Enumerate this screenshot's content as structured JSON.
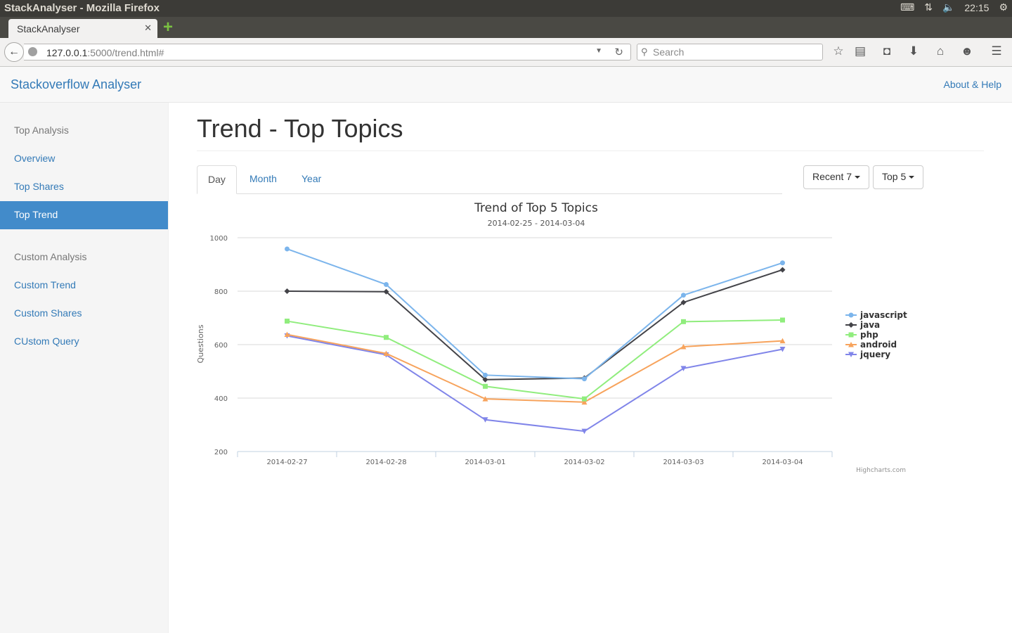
{
  "os": {
    "window_title": "StackAnalyser - Mozilla Firefox",
    "clock": "22:15"
  },
  "browser": {
    "tab_title": "StackAnalyser",
    "url_host": "127.0.0.1",
    "url_rest": ":5000/trend.html#",
    "search_placeholder": "Search"
  },
  "app": {
    "brand": "Stackoverflow Analyser",
    "about_link": "About & Help"
  },
  "sidebar": {
    "top_heading": "Top Analysis",
    "top_items": [
      "Overview",
      "Top Shares",
      "Top Trend"
    ],
    "active_item": "Top Trend",
    "custom_heading": "Custom Analysis",
    "custom_items": [
      "Custom Trend",
      "Custom Shares",
      "CUstom Query"
    ]
  },
  "main": {
    "page_title": "Trend - Top Topics",
    "tabs": [
      "Day",
      "Month",
      "Year"
    ],
    "active_tab": "Day",
    "range_dropdown": "Recent 7",
    "count_dropdown": "Top 5"
  },
  "chart_data": {
    "type": "line",
    "title": "Trend of Top 5 Topics",
    "subtitle": "2014-02-25 - 2014-03-04",
    "ylabel": "Questions",
    "xlabel": "",
    "categories": [
      "2014-02-27",
      "2014-02-28",
      "2014-03-01",
      "2014-03-02",
      "2014-03-03",
      "2014-03-04"
    ],
    "ylim": [
      200,
      1000
    ],
    "yticks": [
      200,
      400,
      600,
      800,
      1000
    ],
    "grid": true,
    "legend_position": "right",
    "credits": "Highcharts.com",
    "series": [
      {
        "name": "javascript",
        "color": "#7cb5ec",
        "marker": "circle",
        "values": [
          958,
          825,
          486,
          472,
          785,
          906
        ]
      },
      {
        "name": "java",
        "color": "#434348",
        "marker": "diamond",
        "values": [
          800,
          798,
          469,
          475,
          758,
          880
        ]
      },
      {
        "name": "php",
        "color": "#90ed7d",
        "marker": "square",
        "values": [
          688,
          627,
          444,
          397,
          686,
          692
        ]
      },
      {
        "name": "android",
        "color": "#f7a35c",
        "marker": "triangle",
        "values": [
          638,
          567,
          397,
          385,
          592,
          614
        ]
      },
      {
        "name": "jquery",
        "color": "#8085e9",
        "marker": "triangle-down",
        "values": [
          633,
          562,
          319,
          276,
          511,
          583
        ]
      }
    ]
  }
}
